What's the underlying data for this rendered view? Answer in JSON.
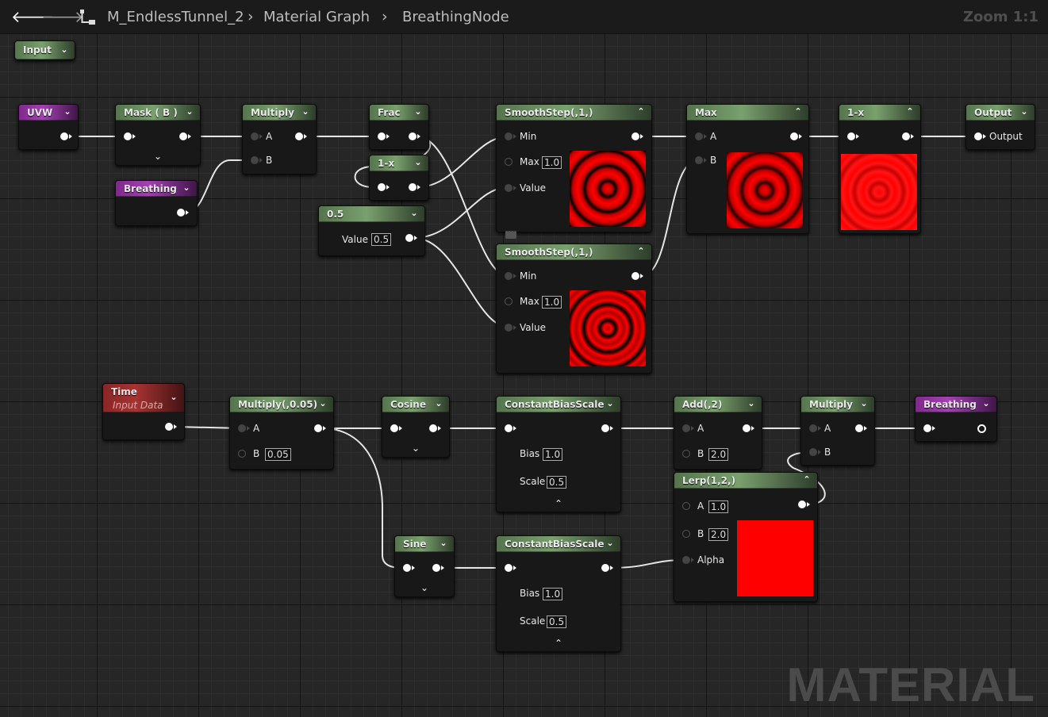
{
  "toolbar": {
    "back_icon": "back-arrow-icon",
    "forward_icon": "forward-arrow-icon",
    "hierarchy_icon": "hierarchy-icon",
    "breadcrumbs": [
      "M_EndlessTunnel_2",
      "Material Graph",
      "BreathingNode"
    ],
    "zoom": "Zoom 1:1"
  },
  "watermark": "MATERIAL",
  "colors": {
    "canvas": "#262626",
    "node_header_green": "#6a8f5e",
    "node_header_purple": "#a341b2",
    "node_header_red": "#a83232",
    "wire": "#e8e8e8",
    "preview_red": "#ff0000"
  },
  "nodes": {
    "input": {
      "title": "Input"
    },
    "uvw": {
      "title": "UVW"
    },
    "mask": {
      "title": "Mask ( B )"
    },
    "multiply1": {
      "title": "Multiply",
      "a": "A",
      "b": "B"
    },
    "breathing_in": {
      "title": "Breathing"
    },
    "frac": {
      "title": "Frac"
    },
    "one_minus_small": {
      "title": "1-x"
    },
    "const05": {
      "title": "0.5",
      "value_label": "Value",
      "value": "0.5"
    },
    "smoothstep1": {
      "title": "SmoothStep(,1,)",
      "min": "Min",
      "max": "Max",
      "max_val": "1.0",
      "value": "Value"
    },
    "smoothstep2": {
      "title": "SmoothStep(,1,)",
      "min": "Min",
      "max": "Max",
      "max_val": "1.0",
      "value": "Value"
    },
    "max": {
      "title": "Max",
      "a": "A",
      "b": "B"
    },
    "one_minus_big": {
      "title": "1-x"
    },
    "output": {
      "title": "Output",
      "pin": "Output"
    },
    "time": {
      "title": "Time",
      "subtitle": "Input Data"
    },
    "multiply005": {
      "title": "Multiply(,0.05)",
      "a": "A",
      "b": "B",
      "b_val": "0.05"
    },
    "cosine": {
      "title": "Cosine"
    },
    "sine": {
      "title": "Sine"
    },
    "cbs1": {
      "title": "ConstantBiasScale",
      "bias": "Bias",
      "bias_val": "1.0",
      "scale": "Scale",
      "scale_val": "0.5"
    },
    "cbs2": {
      "title": "ConstantBiasScale",
      "bias": "Bias",
      "bias_val": "1.0",
      "scale": "Scale",
      "scale_val": "0.5"
    },
    "add2": {
      "title": "Add(,2)",
      "a": "A",
      "b": "B",
      "b_val": "2.0"
    },
    "multiply2": {
      "title": "Multiply",
      "a": "A",
      "b": "B"
    },
    "breathing_out": {
      "title": "Breathing"
    },
    "lerp": {
      "title": "Lerp(1,2,)",
      "a": "A",
      "a_val": "1.0",
      "b": "B",
      "b_val": "2.0",
      "alpha": "Alpha"
    }
  }
}
